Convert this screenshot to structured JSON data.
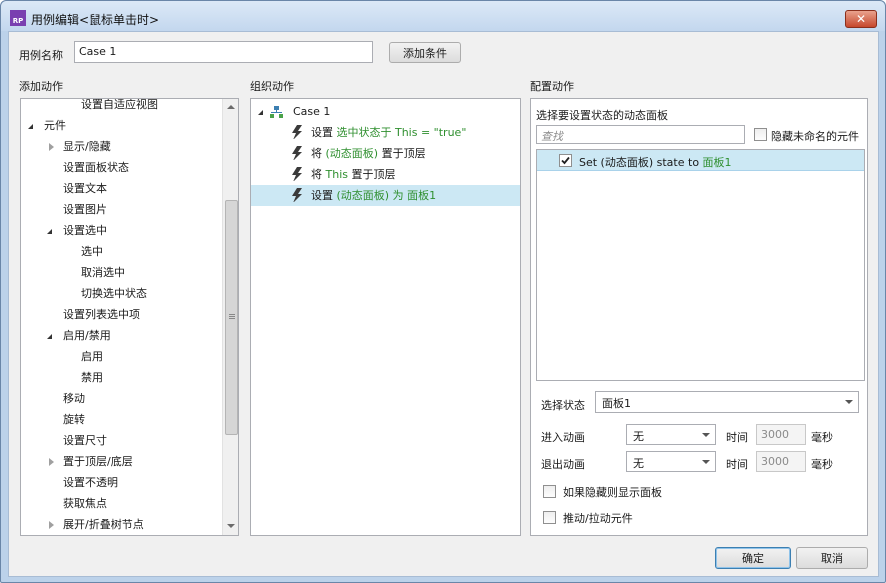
{
  "window": {
    "app_icon": "RP",
    "title": "用例编辑<鼠标单击时>",
    "close_icon": "close-icon"
  },
  "case_name": {
    "label": "用例名称",
    "value": "Case 1",
    "add_condition": "添加条件"
  },
  "add_actions": {
    "header": "添加动作",
    "items": [
      {
        "label": "设置自适应视图",
        "level": 2,
        "toggle": "none"
      },
      {
        "label": "元件",
        "level": 0,
        "toggle": "open"
      },
      {
        "label": "显示/隐藏",
        "level": 1,
        "toggle": "closed"
      },
      {
        "label": "设置面板状态",
        "level": 1,
        "toggle": "none"
      },
      {
        "label": "设置文本",
        "level": 1,
        "toggle": "none"
      },
      {
        "label": "设置图片",
        "level": 1,
        "toggle": "none"
      },
      {
        "label": "设置选中",
        "level": 1,
        "toggle": "open"
      },
      {
        "label": "选中",
        "level": 2,
        "toggle": "none"
      },
      {
        "label": "取消选中",
        "level": 2,
        "toggle": "none"
      },
      {
        "label": "切换选中状态",
        "level": 2,
        "toggle": "none"
      },
      {
        "label": "设置列表选中项",
        "level": 1,
        "toggle": "none"
      },
      {
        "label": "启用/禁用",
        "level": 1,
        "toggle": "open"
      },
      {
        "label": "启用",
        "level": 2,
        "toggle": "none"
      },
      {
        "label": "禁用",
        "level": 2,
        "toggle": "none"
      },
      {
        "label": "移动",
        "level": 1,
        "toggle": "none"
      },
      {
        "label": "旋转",
        "level": 1,
        "toggle": "none"
      },
      {
        "label": "设置尺寸",
        "level": 1,
        "toggle": "none"
      },
      {
        "label": "置于顶层/底层",
        "level": 1,
        "toggle": "closed"
      },
      {
        "label": "设置不透明",
        "level": 1,
        "toggle": "none"
      },
      {
        "label": "获取焦点",
        "level": 1,
        "toggle": "none"
      },
      {
        "label": "展开/折叠树节点",
        "level": 1,
        "toggle": "closed"
      }
    ]
  },
  "organize_actions": {
    "header": "组织动作",
    "case_label": "Case 1",
    "actions": [
      {
        "prefix": "设置 ",
        "highlight": "选中状态于 This = \"true\"",
        "suffix": ""
      },
      {
        "prefix": "将 ",
        "highlight": "(动态面板)",
        "suffix": " 置于顶层"
      },
      {
        "prefix": "将 ",
        "highlight": "This",
        "suffix": " 置于顶层"
      },
      {
        "prefix": "设置 ",
        "highlight": "(动态面板) 为 面板1",
        "suffix": ""
      }
    ],
    "selected_index": 3
  },
  "configure": {
    "header": "配置动作",
    "subheader": "选择要设置状态的动态面板",
    "search_placeholder": "查找",
    "hide_unnamed": "隐藏未命名的元件",
    "panel_item_prefix": "Set (动态面板) state to ",
    "panel_item_highlight": "面板1",
    "panel_item_checked": true,
    "select_state_label": "选择状态",
    "select_state_value": "面板1",
    "enter_anim_label": "进入动画",
    "enter_anim_value": "无",
    "exit_anim_label": "退出动画",
    "exit_anim_value": "无",
    "time_label": "时间",
    "time_value": "3000",
    "ms_label": "毫秒",
    "show_if_hidden": "如果隐藏则显示面板",
    "push_pull": "推动/拉动元件"
  },
  "footer": {
    "ok": "确定",
    "cancel": "取消"
  },
  "colors": {
    "highlight_text": "#2f8f2f",
    "selection_bg": "#cce8f4",
    "accent_border": "#3c7fb1"
  }
}
